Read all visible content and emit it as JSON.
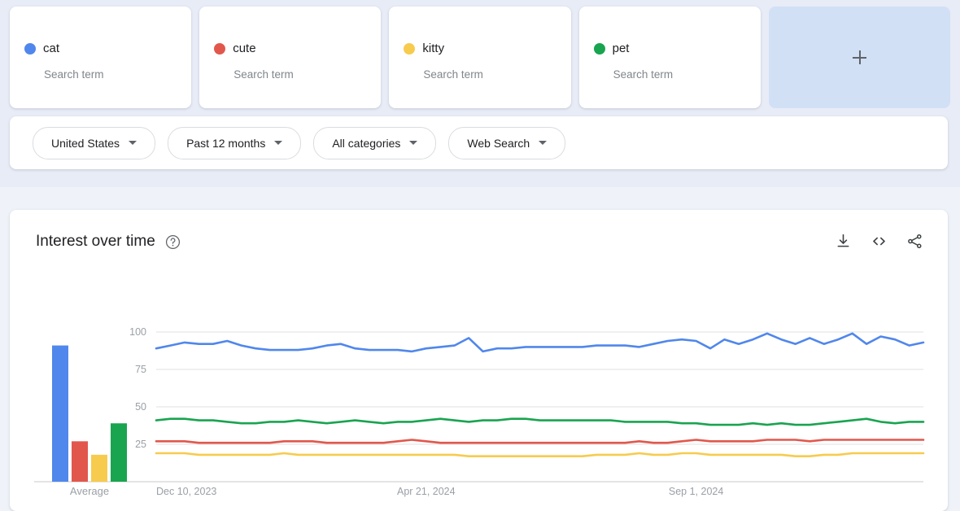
{
  "terms": [
    {
      "name": "cat",
      "type": "Search term",
      "color": "#5087ec"
    },
    {
      "name": "cute",
      "type": "Search term",
      "color": "#e2574c"
    },
    {
      "name": "kitty",
      "type": "Search term",
      "color": "#f7cb4d"
    },
    {
      "name": "pet",
      "type": "Search term",
      "color": "#19a450"
    }
  ],
  "add_button": {
    "label": "+",
    "icon": "plus-icon"
  },
  "filters": [
    {
      "label": "United States",
      "icon": "chevron-down-icon"
    },
    {
      "label": "Past 12 months",
      "icon": "chevron-down-icon"
    },
    {
      "label": "All categories",
      "icon": "chevron-down-icon"
    },
    {
      "label": "Web Search",
      "icon": "chevron-down-icon"
    }
  ],
  "chart_card": {
    "title": "Interest over time",
    "help_icon": "help-circle-icon",
    "actions": [
      {
        "name": "download-icon"
      },
      {
        "name": "embed-code-icon"
      },
      {
        "name": "share-icon"
      }
    ]
  },
  "chart_data": {
    "type": "line",
    "title": "Interest over time",
    "xlabel": "",
    "ylabel": "",
    "ylim": [
      0,
      105
    ],
    "yticks": [
      25,
      50,
      75,
      100
    ],
    "ytick_labels": [
      "25",
      "50",
      "75",
      "100"
    ],
    "grid": true,
    "legend_position": "top-cards",
    "xtick_labels": [
      "Dec 10, 2023",
      "Apr 21, 2024",
      "Sep 1, 2024"
    ],
    "xtick_positions": [
      0,
      19,
      38
    ],
    "n_points": 53,
    "series": [
      {
        "name": "cat",
        "color": "#5087ec",
        "average": 91,
        "values": [
          89,
          91,
          93,
          92,
          92,
          94,
          91,
          89,
          88,
          88,
          88,
          89,
          91,
          92,
          89,
          88,
          88,
          88,
          87,
          89,
          90,
          91,
          96,
          87,
          89,
          89,
          90,
          90,
          90,
          90,
          90,
          91,
          91,
          91,
          90,
          92,
          94,
          95,
          94,
          89,
          95,
          92,
          95,
          99,
          95,
          92,
          96,
          92,
          95,
          99,
          92,
          97,
          95,
          91,
          93
        ]
      },
      {
        "name": "pet",
        "color": "#19a450",
        "average": 39,
        "values": [
          41,
          42,
          42,
          41,
          41,
          40,
          39,
          39,
          40,
          40,
          41,
          40,
          39,
          40,
          41,
          40,
          39,
          40,
          40,
          41,
          42,
          41,
          40,
          41,
          41,
          42,
          42,
          41,
          41,
          41,
          41,
          41,
          41,
          40,
          40,
          40,
          40,
          39,
          39,
          38,
          38,
          38,
          39,
          38,
          39,
          38,
          38,
          39,
          40,
          41,
          42,
          40,
          39,
          40,
          40
        ]
      },
      {
        "name": "cute",
        "color": "#e2574c",
        "average": 27,
        "values": [
          27,
          27,
          27,
          26,
          26,
          26,
          26,
          26,
          26,
          27,
          27,
          27,
          26,
          26,
          26,
          26,
          26,
          27,
          28,
          27,
          26,
          26,
          26,
          26,
          26,
          26,
          26,
          26,
          26,
          26,
          26,
          26,
          26,
          26,
          27,
          26,
          26,
          27,
          28,
          27,
          27,
          27,
          27,
          28,
          28,
          28,
          27,
          28,
          28,
          28,
          28,
          28,
          28,
          28,
          28
        ]
      },
      {
        "name": "kitty",
        "color": "#f7cb4d",
        "average": 18,
        "values": [
          19,
          19,
          19,
          18,
          18,
          18,
          18,
          18,
          18,
          19,
          18,
          18,
          18,
          18,
          18,
          18,
          18,
          18,
          18,
          18,
          18,
          18,
          17,
          17,
          17,
          17,
          17,
          17,
          17,
          17,
          17,
          18,
          18,
          18,
          19,
          18,
          18,
          19,
          19,
          18,
          18,
          18,
          18,
          18,
          18,
          17,
          17,
          18,
          18,
          19,
          19,
          19,
          19,
          19,
          19
        ]
      }
    ],
    "average_panel": {
      "label": "Average",
      "bars": [
        {
          "name": "cat",
          "value": 91,
          "color": "#5087ec"
        },
        {
          "name": "cute",
          "value": 27,
          "color": "#e2574c"
        },
        {
          "name": "kitty",
          "value": 18,
          "color": "#f7cb4d"
        },
        {
          "name": "pet",
          "value": 39,
          "color": "#19a450"
        }
      ]
    }
  }
}
